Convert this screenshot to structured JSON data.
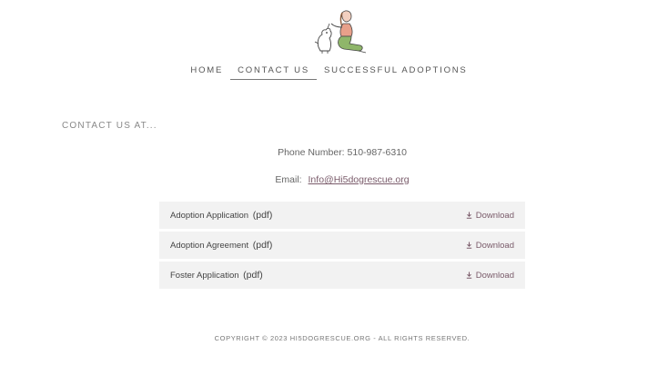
{
  "nav": {
    "items": [
      {
        "label": "HOME"
      },
      {
        "label": "CONTACT US",
        "active": true
      },
      {
        "label": "SUCCESSFUL ADOPTIONS"
      }
    ]
  },
  "section_title": "CONTACT US AT...",
  "phone": "Phone Number: 510-987-6310",
  "email": {
    "label": "Email:",
    "value": "Info@Hi5dogrescue.org"
  },
  "downloads": [
    {
      "name": "Adoption Application",
      "ext": "(pdf)",
      "action": "Download"
    },
    {
      "name": "Adoption Agreement",
      "ext": "(pdf)",
      "action": "Download"
    },
    {
      "name": "Foster Application",
      "ext": "(pdf)",
      "action": "Download"
    }
  ],
  "footer": "COPYRIGHT © 2023 HI5DOGRESCUE.ORG - ALL RIGHTS RESERVED.",
  "colors": {
    "accent": "#7a5b6a",
    "row_bg": "#f2f2f2",
    "logo_green": "#8fb66a",
    "logo_skin": "#e8a08a"
  }
}
